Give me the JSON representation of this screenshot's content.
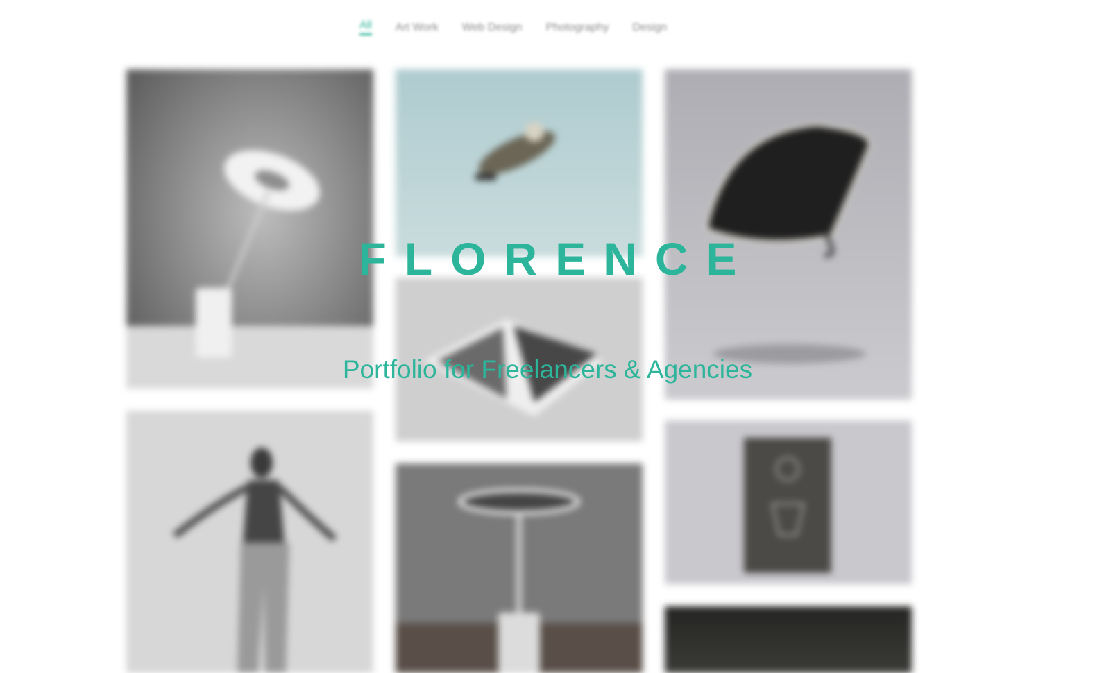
{
  "nav": {
    "items": [
      {
        "label": "All",
        "active": true
      },
      {
        "label": "Art Work",
        "active": false
      },
      {
        "label": "Web Design",
        "active": false
      },
      {
        "label": "Photography",
        "active": false
      },
      {
        "label": "Design",
        "active": false
      }
    ]
  },
  "hero": {
    "title": "FLORENCE",
    "subtitle": "Portfolio for Freelancers & Agencies"
  },
  "gallery": {
    "items": [
      {
        "subject": "table-lamp"
      },
      {
        "subject": "floating-astronaut"
      },
      {
        "subject": "black-umbrella"
      },
      {
        "subject": "open-magazine"
      },
      {
        "subject": "dancer"
      },
      {
        "subject": "round-table-lamp"
      },
      {
        "subject": "book-cover"
      },
      {
        "subject": "dark-tile"
      }
    ]
  },
  "colors": {
    "accent": "#2cb59a",
    "nav_text": "#8a8a8a"
  }
}
